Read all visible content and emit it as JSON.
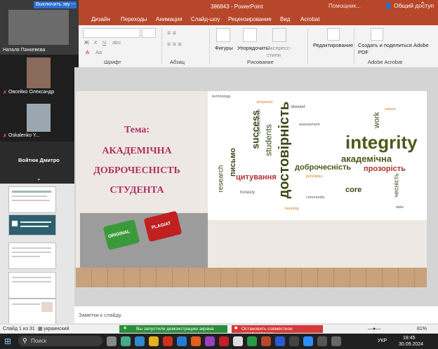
{
  "window": {
    "doc_title": "386843 - PowerPoint",
    "search_placeholder": "Помощник...",
    "share_label": "Общий доступ"
  },
  "tabs": [
    "Дизайн",
    "Переходы",
    "Анимация",
    "Слайд-шоу",
    "Рецензирование",
    "Вид",
    "Acrobat"
  ],
  "ribbon": {
    "groups": {
      "font": "Шрифт",
      "paragraph": "Абзац",
      "drawing": "Рисование",
      "editing_group": "",
      "acrobat": "Adobe Acrobat"
    },
    "shapes": "Фигуры",
    "arrange": "Упорядочить",
    "express": "Экспресс-стили",
    "editing": "Редактирование",
    "create_share": "Создать и поделиться Adobe PDF"
  },
  "video": {
    "mute_button": "Выключить звук",
    "participants": [
      {
        "name": "Наталя Панкевєва"
      },
      {
        "name": "Овсейко Олександр"
      },
      {
        "name": "Oskalenko Y..."
      }
    ],
    "presenter": "Войтюк Дмитро"
  },
  "slide": {
    "topic_label": "Тема:",
    "line1": "АКАДЕМІЧНА",
    "line2": "ДОБРОЧЕСНІСТЬ",
    "line3": "СТУДЕНТА",
    "keys": [
      "ORIGINAL",
      "PLAGIAT"
    ]
  },
  "wordcloud": [
    {
      "t": "integrity",
      "c": "#4a5a1a"
    },
    {
      "t": "академічна",
      "c": "#4a5a1a"
    },
    {
      "t": "доброчесність",
      "c": "#4a5a1a"
    },
    {
      "t": "достовірність",
      "c": "#3c4a18"
    },
    {
      "t": "прозорість",
      "c": "#b03030"
    },
    {
      "t": "цитування",
      "c": "#b03030"
    },
    {
      "t": "success",
      "c": "#3c4a18"
    },
    {
      "t": "students",
      "c": "#3c4a18"
    },
    {
      "t": "core",
      "c": "#3c4a18"
    },
    {
      "t": "письмо",
      "c": "#3c4a18"
    },
    {
      "t": "research",
      "c": "#3c4a18"
    },
    {
      "t": "work",
      "c": "#3c4a18"
    },
    {
      "t": "чесність",
      "c": "#3c4a18"
    },
    {
      "t": "honesty",
      "c": "#555"
    },
    {
      "t": "technology",
      "c": "#555"
    },
    {
      "t": "phenomenon",
      "c": "#555"
    },
    {
      "t": "skewed",
      "c": "#555"
    },
    {
      "t": "prepared",
      "c": "#e07a20"
    },
    {
      "t": "assessment",
      "c": "#555"
    },
    {
      "t": "principles",
      "c": "#e07a20"
    },
    {
      "t": "community",
      "c": "#555"
    },
    {
      "t": "values",
      "c": "#e07a20"
    },
    {
      "t": "data",
      "c": "#555"
    },
    {
      "t": "learning",
      "c": "#e07a20"
    }
  ],
  "notes_placeholder": "Заметки к слайду",
  "status": {
    "slide_of": "Слайд 1 из 31",
    "language": "украинский",
    "demo_banner": "Вы запустили демонстрацию экрана",
    "stop_sharing": "Остановить совместное использование",
    "zoom": "81%"
  },
  "taskbar": {
    "search": "Поиск",
    "lang": "УКР",
    "time": "18:45",
    "date": "30.09.2024"
  },
  "colors": {
    "accent": "#b7472a",
    "topic": "#b03060"
  }
}
